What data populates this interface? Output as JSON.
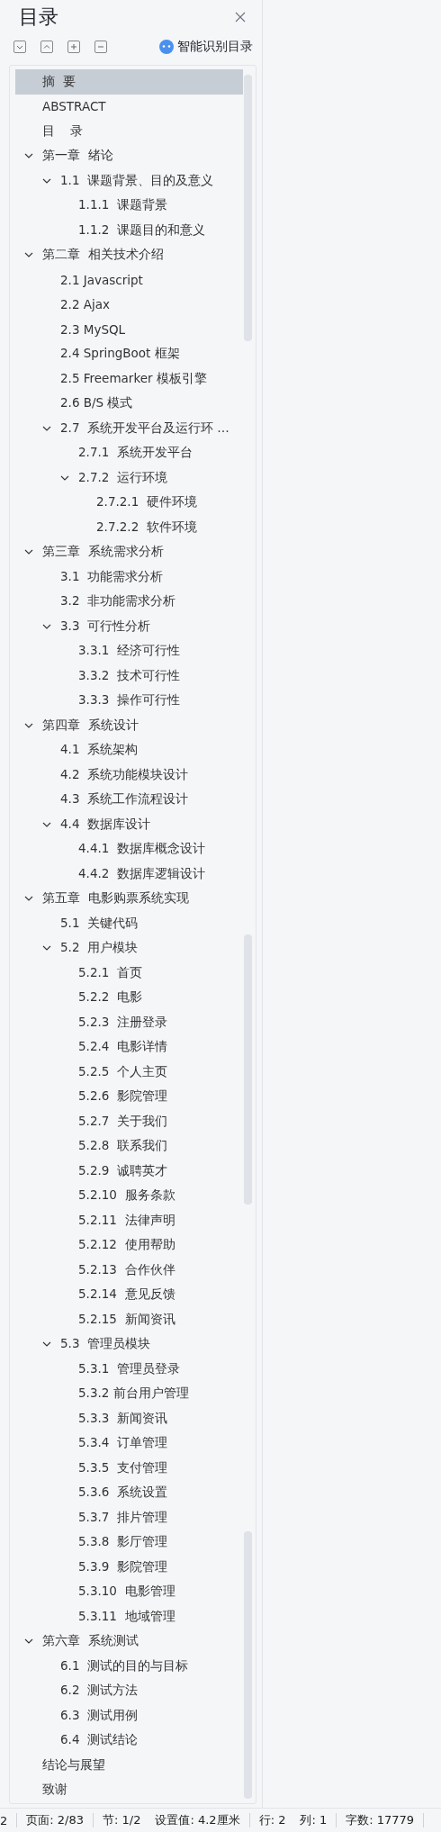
{
  "pane": {
    "title": "目录",
    "smart_button": "智能识别目录"
  },
  "toolbar": [
    {
      "kind": "expand_down"
    },
    {
      "kind": "collapse_up"
    },
    {
      "kind": "plus"
    },
    {
      "kind": "minus"
    }
  ],
  "tree": [
    {
      "label": "摘  要",
      "selected": true
    },
    {
      "label": "ABSTRACT",
      "selected": false
    },
    {
      "label": "目    录",
      "selected": false
    },
    {
      "label": "第一章  绪论",
      "selected": false,
      "expanded": true,
      "children": [
        {
          "label": "1.1  课题背景、目的及意义",
          "selected": false,
          "expanded": true,
          "children": [
            {
              "label": "1.1.1  课题背景",
              "selected": false
            },
            {
              "label": "1.1.2  课题目的和意义",
              "selected": false
            }
          ]
        }
      ]
    },
    {
      "label": "第二章  相关技术介绍",
      "selected": false,
      "expanded": true,
      "children": [
        {
          "label": "2.1 Javascript",
          "selected": false
        },
        {
          "label": "2.2 Ajax",
          "selected": false
        },
        {
          "label": "2.3 MySQL",
          "selected": false
        },
        {
          "label": "2.4 SpringBoot 框架",
          "selected": false
        },
        {
          "label": "2.5 Freemarker 模板引擎",
          "selected": false
        },
        {
          "label": "2.6 B/S 模式",
          "selected": false
        },
        {
          "label": "2.7  系统开发平台及运行环 …",
          "selected": false,
          "expanded": true,
          "children": [
            {
              "label": "2.7.1  系统开发平台",
              "selected": false
            },
            {
              "label": "2.7.2  运行环境",
              "selected": false,
              "expanded": true,
              "children": [
                {
                  "label": "2.7.2.1  硬件环境",
                  "selected": false
                },
                {
                  "label": "2.7.2.2  软件环境",
                  "selected": false
                }
              ]
            }
          ]
        }
      ]
    },
    {
      "label": "第三章  系统需求分析",
      "selected": false,
      "expanded": true,
      "children": [
        {
          "label": "3.1  功能需求分析",
          "selected": false
        },
        {
          "label": "3.2  非功能需求分析",
          "selected": false
        },
        {
          "label": "3.3  可行性分析",
          "selected": false,
          "expanded": true,
          "children": [
            {
              "label": "3.3.1  经济可行性",
              "selected": false
            },
            {
              "label": "3.3.2  技术可行性",
              "selected": false
            },
            {
              "label": "3.3.3  操作可行性",
              "selected": false
            }
          ]
        }
      ]
    },
    {
      "label": "第四章  系统设计",
      "selected": false,
      "expanded": true,
      "children": [
        {
          "label": "4.1  系统架构",
          "selected": false
        },
        {
          "label": "4.2  系统功能模块设计",
          "selected": false
        },
        {
          "label": "4.3  系统工作流程设计",
          "selected": false
        },
        {
          "label": "4.4  数据库设计",
          "selected": false,
          "expanded": true,
          "children": [
            {
              "label": "4.4.1  数据库概念设计",
              "selected": false
            },
            {
              "label": "4.4.2  数据库逻辑设计",
              "selected": false
            }
          ]
        }
      ]
    },
    {
      "label": "第五章  电影购票系统实现",
      "selected": false,
      "expanded": true,
      "children": [
        {
          "label": "5.1  关键代码",
          "selected": false
        },
        {
          "label": "5.2  用户模块",
          "selected": false,
          "expanded": true,
          "children": [
            {
              "label": "5.2.1  首页",
              "selected": false
            },
            {
              "label": "5.2.2  电影",
              "selected": false
            },
            {
              "label": "5.2.3  注册登录",
              "selected": false
            },
            {
              "label": "5.2.4  电影详情",
              "selected": false
            },
            {
              "label": "5.2.5  个人主页",
              "selected": false
            },
            {
              "label": "5.2.6  影院管理",
              "selected": false
            },
            {
              "label": "5.2.7  关于我们",
              "selected": false
            },
            {
              "label": "5.2.8  联系我们",
              "selected": false
            },
            {
              "label": "5.2.9  诚聘英才",
              "selected": false
            },
            {
              "label": "5.2.10  服务条款",
              "selected": false
            },
            {
              "label": "5.2.11  法律声明",
              "selected": false
            },
            {
              "label": "5.2.12  使用帮助",
              "selected": false
            },
            {
              "label": "5.2.13  合作伙伴",
              "selected": false
            },
            {
              "label": "5.2.14  意见反馈",
              "selected": false
            },
            {
              "label": "5.2.15  新闻资讯",
              "selected": false
            }
          ]
        },
        {
          "label": "5.3  管理员模块",
          "selected": false,
          "expanded": true,
          "children": [
            {
              "label": "5.3.1  管理员登录",
              "selected": false
            },
            {
              "label": "5.3.2 前台用户管理",
              "selected": false
            },
            {
              "label": "5.3.3  新闻资讯",
              "selected": false
            },
            {
              "label": "5.3.4  订单管理",
              "selected": false
            },
            {
              "label": "5.3.5  支付管理",
              "selected": false
            },
            {
              "label": "5.3.6  系统设置",
              "selected": false
            },
            {
              "label": "5.3.7  排片管理",
              "selected": false
            },
            {
              "label": "5.3.8  影厅管理",
              "selected": false
            },
            {
              "label": "5.3.9  影院管理",
              "selected": false
            },
            {
              "label": "5.3.10  电影管理",
              "selected": false
            },
            {
              "label": "5.3.11  地域管理",
              "selected": false
            }
          ]
        }
      ]
    },
    {
      "label": "第六章  系统测试",
      "selected": false,
      "expanded": true,
      "children": [
        {
          "label": "6.1  测试的目的与目标",
          "selected": false
        },
        {
          "label": "6.2  测试方法",
          "selected": false
        },
        {
          "label": "6.3  测试用例",
          "selected": false
        },
        {
          "label": "6.4  测试结论",
          "selected": false
        }
      ]
    },
    {
      "label": "结论与展望",
      "selected": false
    },
    {
      "label": "致谢",
      "selected": false
    }
  ],
  "status_bar": [
    [
      "2"
    ],
    [
      "页面: 2/83"
    ],
    [
      "节: 1/2",
      "设置值: 4.2厘米"
    ],
    [
      "行: 2",
      "列: 1"
    ],
    [
      "字数: 17779"
    ]
  ]
}
